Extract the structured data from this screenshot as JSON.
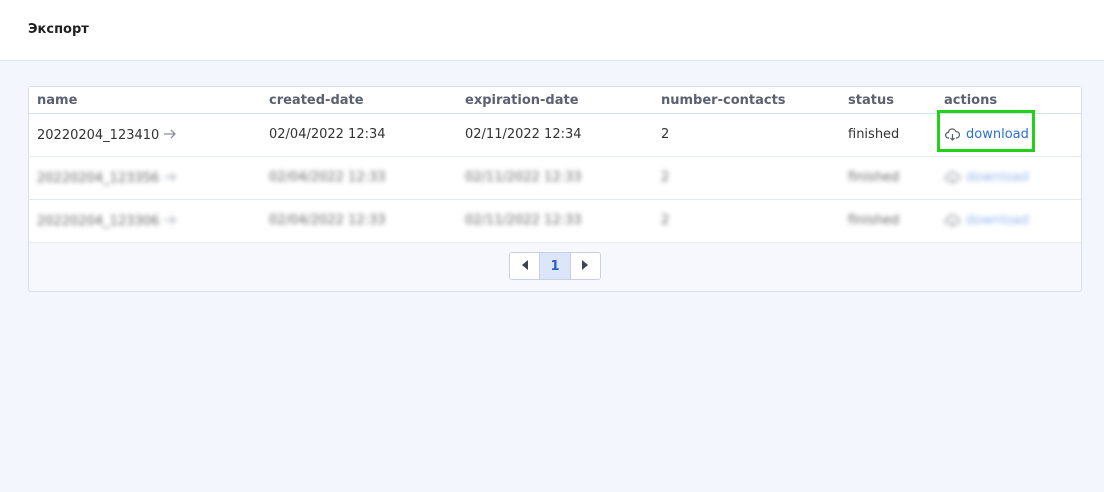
{
  "page": {
    "title": "Экспорт"
  },
  "table": {
    "columns": [
      "name",
      "created-date",
      "expiration-date",
      "number-contacts",
      "status",
      "actions"
    ],
    "rows": [
      {
        "name": "20220204_123410",
        "created": "02/04/2022 12:34",
        "expiration": "02/11/2022 12:34",
        "contacts": "2",
        "status": "finished",
        "action": "download"
      },
      {
        "name": "20220204_123356",
        "created": "02/04/2022 12:33",
        "expiration": "02/11/2022 12:33",
        "contacts": "2",
        "status": "finished",
        "action": "download"
      },
      {
        "name": "20220204_123306",
        "created": "02/04/2022 12:33",
        "expiration": "02/11/2022 12:33",
        "contacts": "2",
        "status": "finished",
        "action": "download"
      }
    ]
  },
  "pagination": {
    "current_page": "1",
    "prev_icon": "caret-left-icon",
    "next_icon": "caret-right-icon"
  },
  "colors": {
    "link": "#2a6fd6",
    "highlight": "#22d11a",
    "active_page_bg": "#dbe6fb"
  }
}
